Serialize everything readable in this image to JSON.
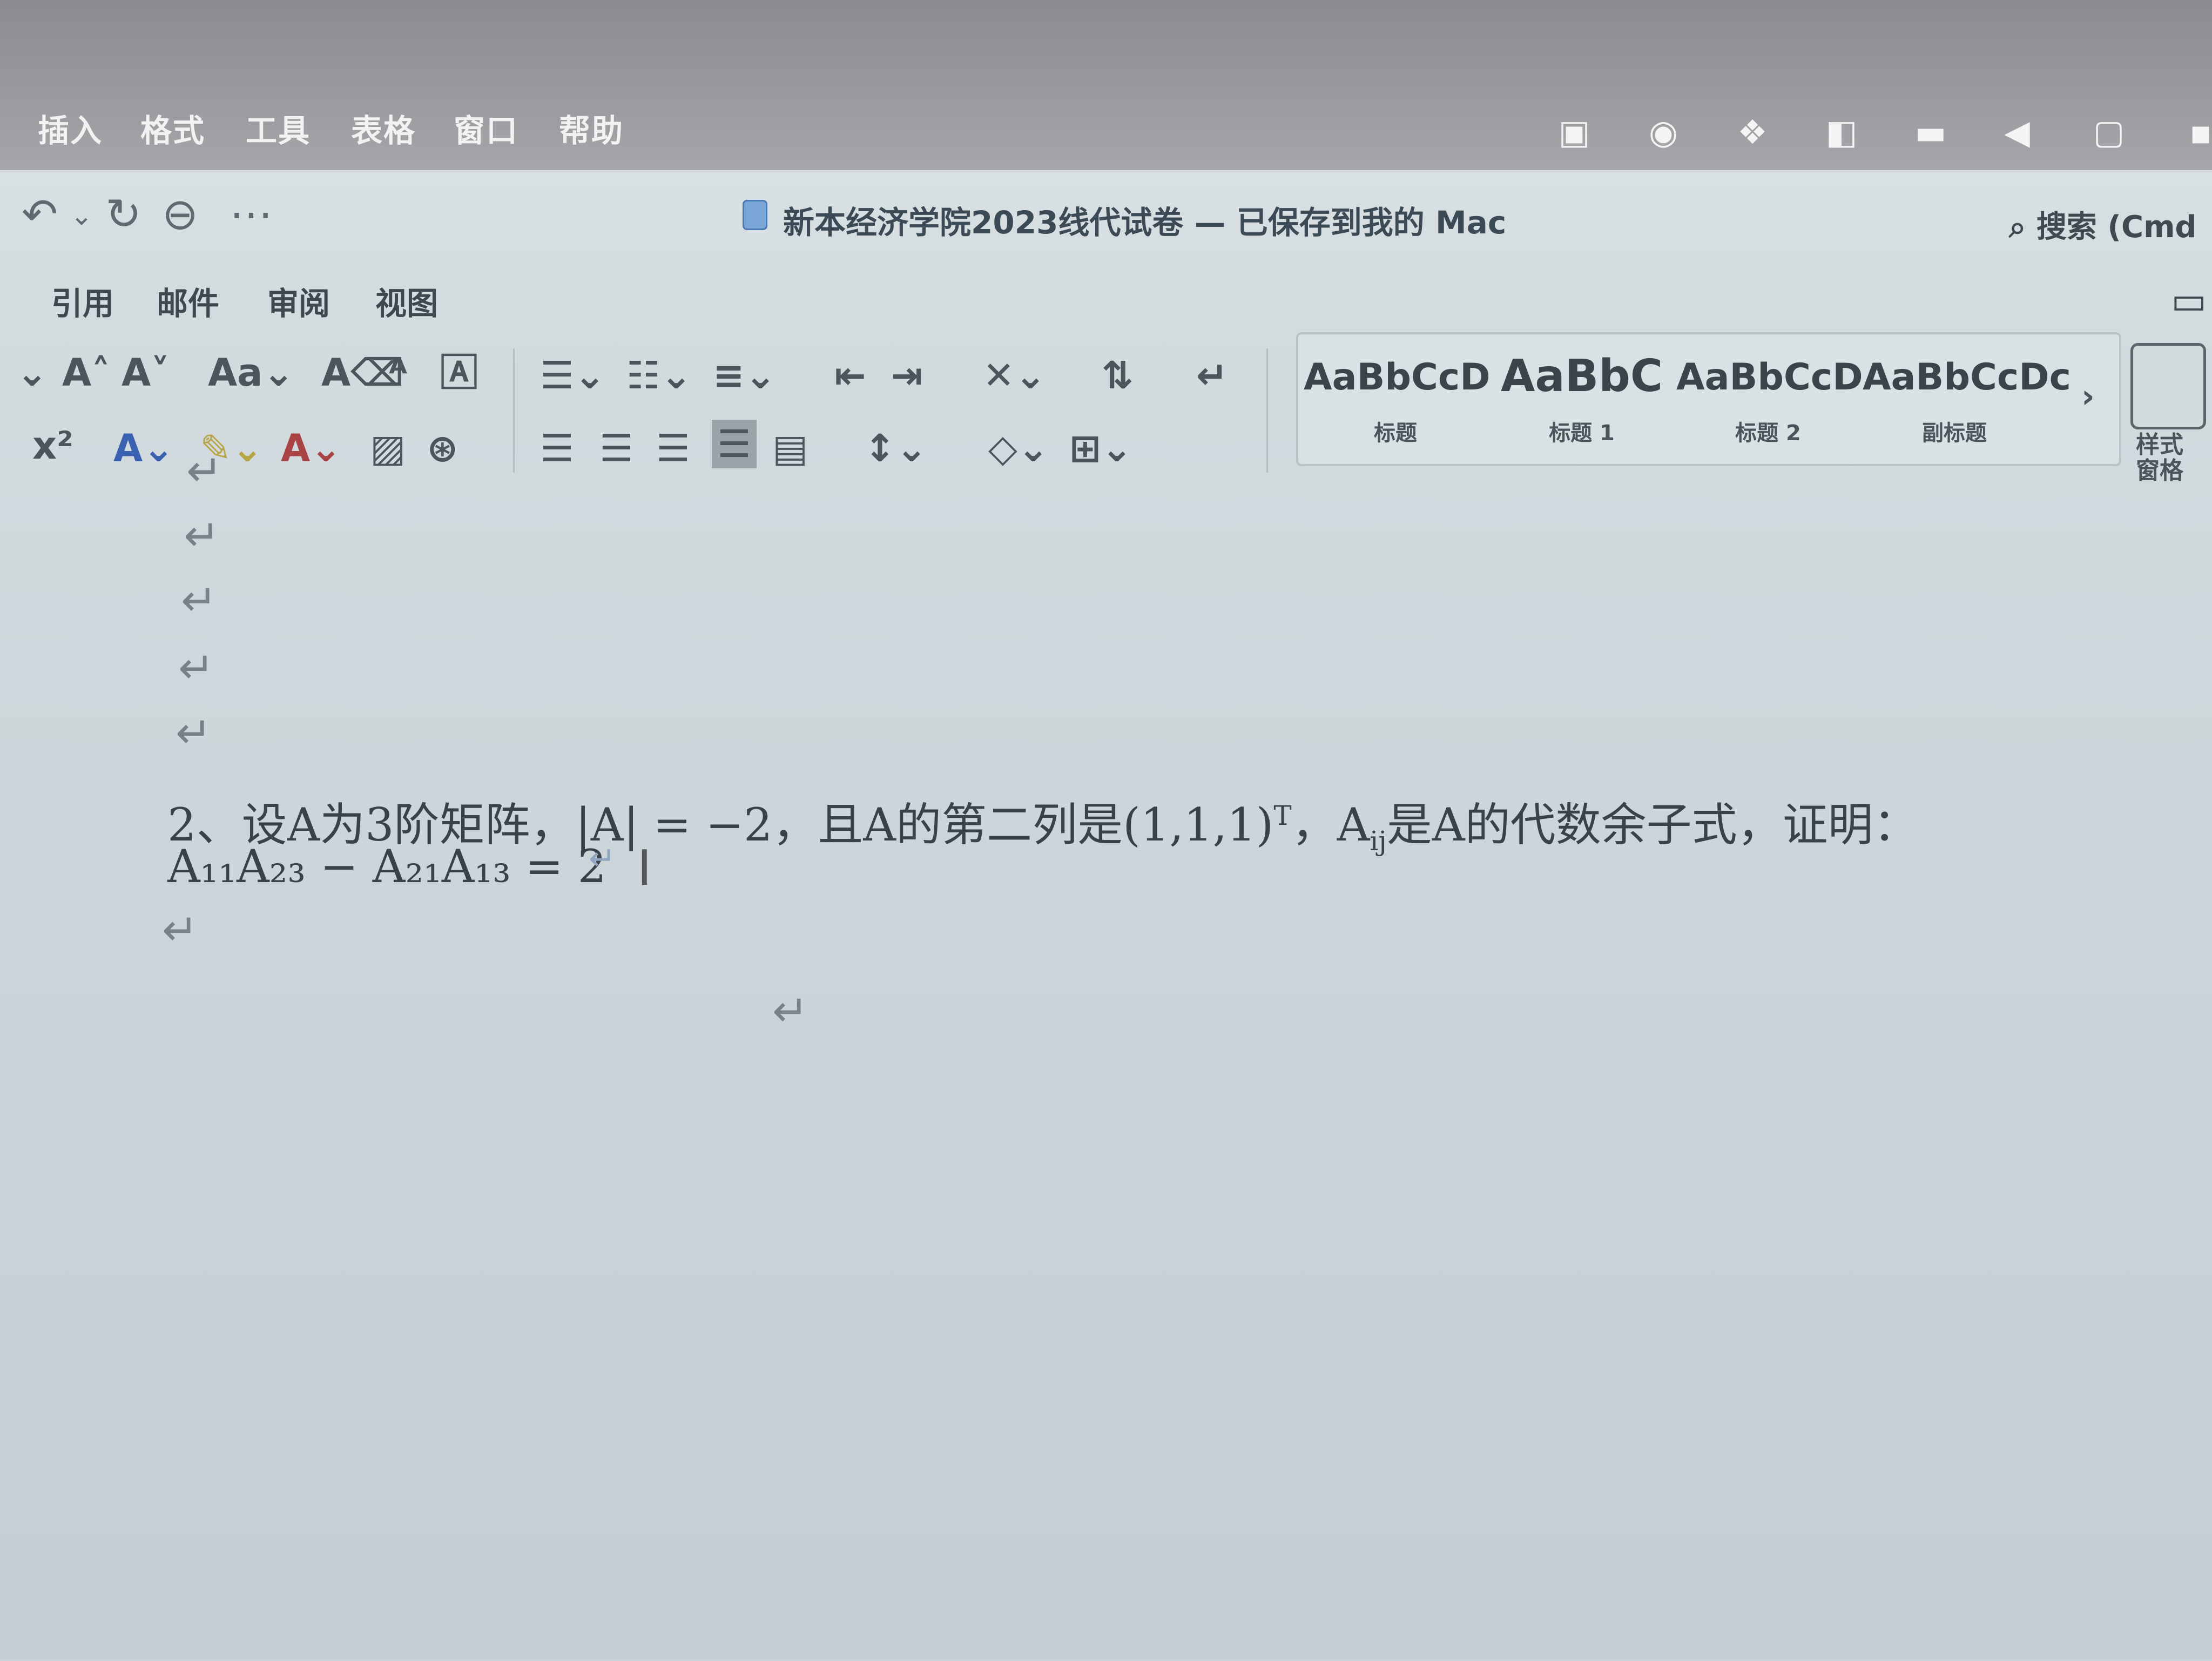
{
  "menubar": {
    "items": [
      "插入",
      "格式",
      "工具",
      "表格",
      "窗口",
      "帮助"
    ]
  },
  "tray": {
    "icons": [
      "wechat-icon",
      "browser-icon",
      "dropbox-icon",
      "input-icon",
      "battery-icon",
      "volume-icon",
      "screen-icon",
      "status-icon"
    ]
  },
  "window": {
    "title": "新本经济学院2023线代试卷 — 已保存到我的 Mac",
    "search_label": "搜索 (Cmd",
    "tabs": [
      "引用",
      "邮件",
      "审阅",
      "视图"
    ]
  },
  "styles": [
    {
      "sample": "AaBbCcD",
      "name": "标题"
    },
    {
      "sample": "AaBbC",
      "name": "标题 1"
    },
    {
      "sample": "AaBbCcD",
      "name": "标题 2"
    },
    {
      "sample": "AaBbCcDc",
      "name": "副标题"
    }
  ],
  "styles_pane_label": "样式\n窗格",
  "document": {
    "question_line1_prefix": "2、设A为3阶矩阵，|A| = −2，且A的第二列是(1,1,1)",
    "question_line1_sup": "T",
    "question_line1_mid": "，A",
    "question_line1_sub": "ij",
    "question_line1_suffix": "是A的代数余子式，证明：",
    "question_line2": "A₁₁A₂₃ − A₂₁A₁₃ = 2"
  }
}
